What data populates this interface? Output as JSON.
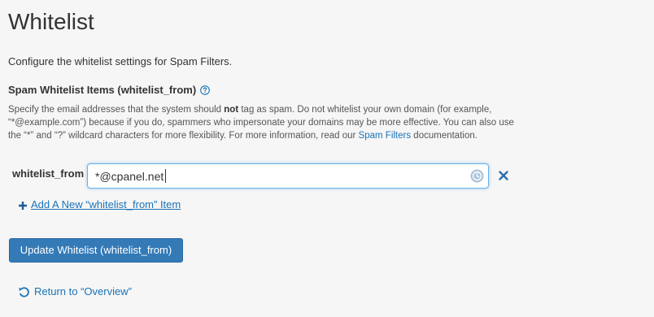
{
  "page": {
    "title": "Whitelist",
    "intro": "Configure the whitelist settings for Spam Filters."
  },
  "section": {
    "label": "Spam Whitelist Items (whitelist_from)",
    "description": {
      "part1": "Specify the email addresses that the system should ",
      "bold": "not",
      "part2": " tag as spam. Do not whitelist your own domain (for example, “*@example.com”) because if you do, spammers who impersonate your domains may be more effective. You can also use the “*” and “?” wildcard characters for more flexibility. For more information, read our ",
      "link": "Spam Filters",
      "part3": " documentation."
    }
  },
  "field": {
    "label": "whitelist_from",
    "value": "*@cpanel.net"
  },
  "actions": {
    "add_item_label": "Add A New “whitelist_from” Item",
    "update_button_label": "Update Whitelist (whitelist_from)",
    "return_label": "Return to “Overview”"
  },
  "colors": {
    "link": "#1a73b8",
    "button_bg": "#337ab7",
    "remove_icon": "#2d6da8",
    "focus_border": "#66afe9"
  },
  "icons": {
    "help": "question-circle-icon",
    "autofill": "password-manager-icon",
    "remove": "close-icon",
    "add": "plus-icon",
    "return": "undo-arrow-icon"
  }
}
